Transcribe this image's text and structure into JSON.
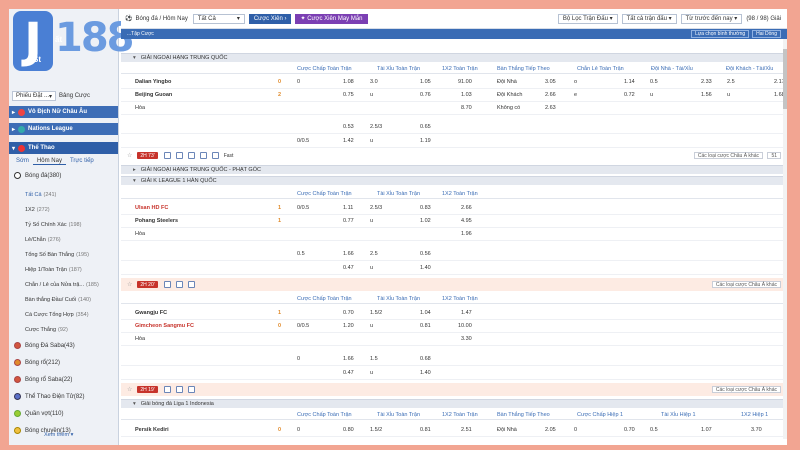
{
  "logo": {
    "letter": "J",
    "number": "188",
    "tag1": "St",
    "tag2": "St",
    "tag3": "ất"
  },
  "sidebar": {
    "filter_select": "Phiếu Đặt ...",
    "filter_link": "Bảng Cược",
    "leagues": [
      {
        "label": "Vô Địch Nữ Châu Âu"
      },
      {
        "label": "Nations League"
      }
    ],
    "sports_header": "Thể Thao",
    "tabs": [
      "Sớm",
      "Hôm Nay",
      "Trực tiếp"
    ],
    "football": {
      "label": "Bóng đá",
      "count": "(380)"
    },
    "bet_types": [
      {
        "label": "Tất Cả",
        "count": "(241)"
      },
      {
        "label": "1X2",
        "count": "(272)"
      },
      {
        "label": "Tỷ Số Chính Xác",
        "count": "(198)"
      },
      {
        "label": "Lẻ/Chẵn",
        "count": "(276)"
      },
      {
        "label": "Tổng Số Bàn Thắng",
        "count": "(195)"
      },
      {
        "label": "Hiệp 1/Toàn Trận",
        "count": "(187)"
      },
      {
        "label": "Chẵn / Lẻ của Nửa trậ...",
        "count": "(185)"
      },
      {
        "label": "Bàn thắng Đầu/ Cuối",
        "count": "(140)"
      },
      {
        "label": "Cá Cược Tổng Hợp",
        "count": "(354)"
      },
      {
        "label": "Cược Thắng",
        "count": "(92)"
      }
    ],
    "sports": [
      {
        "label": "Bóng Đá Saba",
        "count": "(43)"
      },
      {
        "label": "Bóng rổ",
        "count": "(212)"
      },
      {
        "label": "Bóng rổ Saba",
        "count": "(22)"
      },
      {
        "label": "Thể Thao Điện Tử",
        "count": "(82)"
      },
      {
        "label": "Quần vợt",
        "count": "(110)"
      },
      {
        "label": "Bóng chuyền",
        "count": "(13)"
      }
    ],
    "see_more": "Xem thêm"
  },
  "topbar": {
    "sport_title": "Bóng đá / Hôm Nay",
    "all_select": "Tất Cả",
    "bet_button": "Cược Xiên",
    "lucky_button": "Cược Xiên May Mắn",
    "filter_select": "Bộ Lọc Trận Đấu",
    "all_matches_select": "Tất cả trận đấu",
    "sort_select": "Từ trước đến nay",
    "page_count": "(98 / 98) Giải"
  },
  "subbar": {
    "left": "...Tập Cược",
    "view_select": "Lựa chọn bình thường",
    "odds_select": "Hai Dòng"
  },
  "columns": {
    "full_handicap": "Cược Chấp Toàn Trận",
    "full_ou": "Tài Xỉu Toàn Trận",
    "full_1x2": "1X2 Toàn Trận",
    "next_goal": "Bàn Thắng Tiếp Theo",
    "odd_even": "Chẵn Lẻ Toàn Trận",
    "home_ou": "Đội Nhà - Tài/Xỉu",
    "away_ou": "Đội Khách - Tài/Xỉu",
    "h1_handicap": "Cược Chấp Hiệp 1",
    "h1_ou": "Tài Xỉu Hiệp 1",
    "h1_1x2": "1X2 Hiệp 1"
  },
  "leagues": [
    {
      "title": "GIẢI NGOẠI HẠNG TRUNG QUỐC"
    },
    {
      "title": "GIẢI NGOẠI HẠNG TRUNG QUỐC - PHẠT GÓC"
    },
    {
      "title": "GIẢI K LEAGUE 1 HÀN QUỐC"
    },
    {
      "title": "Giải bóng đá Liga 1 Indonesia"
    }
  ],
  "matches": {
    "m1": {
      "home": "Dalian Yingbo",
      "home_score": "0",
      "away": "Beijing Guoan",
      "away_score": "2",
      "draw": "Hòa",
      "r1": {
        "hcap": "0",
        "hodd": "1.08",
        "ou": "3.0",
        "oodd": "1.05",
        "x12": "91.00",
        "ng": "Đội Nhà",
        "ngodd": "3.05",
        "oe": "o",
        "oeodd": "1.14",
        "hou": "0.5",
        "houodd": "2.33",
        "aou": "2.5",
        "aouodd": "2.17"
      },
      "r2": {
        "hodd": "0.75",
        "ou": "u",
        "oodd": "0.76",
        "x12": "1.03",
        "ng": "Đội Khách",
        "ngodd": "2.66",
        "oe": "e",
        "oeodd": "0.72",
        "hou": "u",
        "houodd": "1.56",
        "aou": "u",
        "aouodd": "1.68"
      },
      "r3": {
        "x12": "8.70",
        "ng": "Không có",
        "ngodd": "2.63"
      },
      "r4": {
        "hodd": "0.53",
        "ou": "2.5/3",
        "oodd": "0.65"
      },
      "r5": {
        "hcap": "0/0.5",
        "hodd": "1.42",
        "ou": "u",
        "oodd": "1.19"
      },
      "tool_tag": "2H 73'",
      "tool_flag": "Fast",
      "sel1": "Các loại cược Châu Á khác",
      "sel2": "51"
    },
    "m2": {
      "home": "Ulsan HD FC",
      "home_score": "1",
      "away": "Pohang Steelers",
      "away_score": "1",
      "draw": "Hòa",
      "r1": {
        "hcap": "0/0.5",
        "hodd": "1.11",
        "ou": "2.5/3",
        "oodd": "0.83",
        "x12": "2.66"
      },
      "r2": {
        "hodd": "0.77",
        "ou": "u",
        "oodd": "1.02",
        "x12": "4.95"
      },
      "r3": {
        "x12": "1.96"
      },
      "r4": {
        "hcap": "0.5",
        "hodd": "1.66",
        "ou": "2.5",
        "oodd": "0.56"
      },
      "r5": {
        "hodd": "0.47",
        "ou": "u",
        "oodd": "1.40"
      },
      "tool_tag": "2H 20'",
      "sel1": "Các loại cược Châu Á khác"
    },
    "m3": {
      "home": "Gwangju FC",
      "home_score": "1",
      "away": "Gimcheon Sangmu FC",
      "away_score": "0",
      "draw": "Hòa",
      "r1": {
        "hodd": "0.70",
        "ou": "1.5/2",
        "oodd": "1.04",
        "x12": "1.47"
      },
      "r2": {
        "hcap": "0/0.5",
        "hodd": "1.20",
        "ou": "u",
        "oodd": "0.81",
        "x12": "10.00"
      },
      "r3": {
        "x12": "3.30"
      },
      "r4": {
        "hcap": "0",
        "hodd": "1.66",
        "ou": "1.5",
        "oodd": "0.68"
      },
      "r5": {
        "hodd": "0.47",
        "ou": "u",
        "oodd": "1.40"
      },
      "tool_tag": "2H 19'",
      "sel1": "Các loại cược Châu Á khác"
    },
    "m4": {
      "home": "Persik Kediri",
      "home_score": "0",
      "r1": {
        "hcap": "0",
        "hodd": "0.80",
        "ou": "1.5/2",
        "oodd": "0.81",
        "x12": "2.51",
        "ng": "Đội Nhà",
        "ngodd": "2.05",
        "h1c": "0",
        "h1codd": "0.70",
        "h1o": "0.5",
        "h1oodd": "1.07",
        "h1x": "3.70"
      }
    }
  }
}
